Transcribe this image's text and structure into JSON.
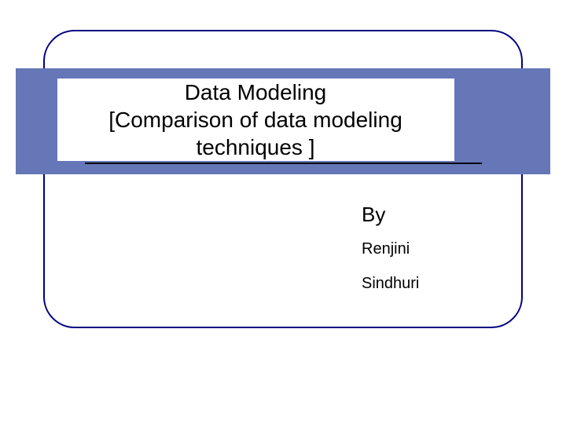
{
  "title": {
    "line1": "Data Modeling",
    "line2": "[Comparison of data modeling",
    "line3": "techniques ]"
  },
  "byLabel": "By",
  "authors": [
    "Renjini",
    "Sindhuri"
  ],
  "colors": {
    "banner": "#6677b8",
    "border": "#000080"
  }
}
